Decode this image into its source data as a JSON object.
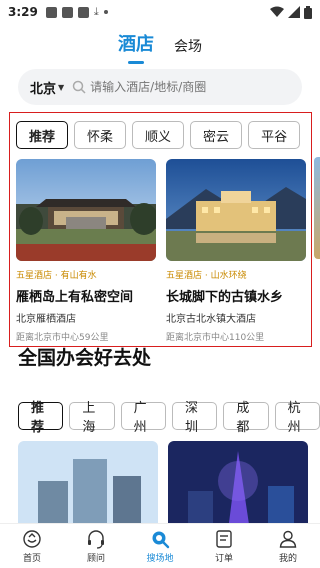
{
  "status_bar": {
    "time": "3:29"
  },
  "top_tabs": [
    {
      "label": "酒店",
      "active": true
    },
    {
      "label": "会场",
      "active": false
    }
  ],
  "search": {
    "city": "北京",
    "placeholder": "请输入酒店/地标/商圈"
  },
  "featured": {
    "chips": [
      {
        "label": "推荐",
        "active": true
      },
      {
        "label": "怀柔",
        "active": false
      },
      {
        "label": "顺义",
        "active": false
      },
      {
        "label": "密云",
        "active": false
      },
      {
        "label": "平谷",
        "active": false
      }
    ],
    "cards": [
      {
        "tag": "五星酒店 · 有山有水",
        "title": "雁栖岛上有私密空间",
        "hotel": "北京雁栖酒店",
        "distance": "距离北京市中心59公里"
      },
      {
        "tag": "五星酒店 · 山水环绕",
        "title": "长城脚下的古镇水乡",
        "hotel": "北京古北水镇大酒店",
        "distance": "距离北京市中心110公里"
      }
    ]
  },
  "section2": {
    "title": "全国办会好去处",
    "chips": [
      {
        "label": "推荐",
        "active": true
      },
      {
        "label": "上海",
        "active": false
      },
      {
        "label": "广州",
        "active": false
      },
      {
        "label": "深圳",
        "active": false
      },
      {
        "label": "成都",
        "active": false
      },
      {
        "label": "杭州",
        "active": false
      }
    ]
  },
  "bottom_nav": [
    {
      "label": "首页",
      "icon": "home-icon",
      "active": false
    },
    {
      "label": "顾问",
      "icon": "headset-icon",
      "active": false
    },
    {
      "label": "搜场地",
      "icon": "search-icon",
      "active": true
    },
    {
      "label": "订单",
      "icon": "order-icon",
      "active": false
    },
    {
      "label": "我的",
      "icon": "user-icon",
      "active": false
    }
  ],
  "colors": {
    "accent": "#1a8ad6",
    "tag": "#c98a00",
    "highlight_border": "#d81e1e"
  }
}
